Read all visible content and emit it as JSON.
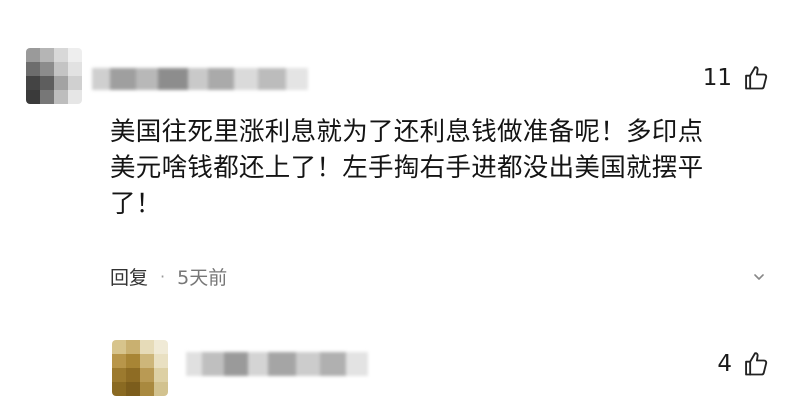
{
  "comments": [
    {
      "likes": "11",
      "text_lines": [
        "美国往死里涨利息就为了还利息钱做准备呢！多印点",
        "美元啥钱都还上了！左手掏右手进都没出美国就摆平",
        "了！"
      ],
      "reply_label": "回复",
      "separator": "·",
      "time": "5天前"
    },
    {
      "likes": "4"
    }
  ],
  "icons": {
    "like": "thumbs-up-icon",
    "more": "chevron-down-icon"
  },
  "colors": {
    "background": "#ffffff",
    "text": "#141414",
    "meta": "#777777"
  }
}
